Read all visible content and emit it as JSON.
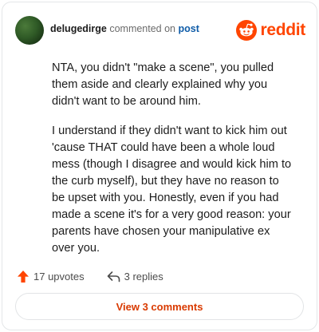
{
  "comment": {
    "username": "delugedirge",
    "action": "commented on",
    "target": "post",
    "paragraphs": [
      "NTA, you didn't \"make a scene\", you pulled them aside and clearly explained why you didn't want to be around him.",
      "I understand if they didn't want to kick him out 'cause THAT could have been a whole loud mess (though I disagree and would kick him to the curb myself), but they have no reason to be upset with you. Honestly, even if you had made a scene it's for a very good reason: your parents have chosen your manipulative ex over you."
    ]
  },
  "brand": {
    "name": "reddit",
    "icon": "reddit-logo-icon",
    "color": "#ff4500"
  },
  "footer": {
    "upvotes": "17 upvotes",
    "replies": "3 replies",
    "upvote_icon": "upvote-arrow-icon",
    "reply_icon": "reply-arrow-icon",
    "upvote_color": "#ff4500"
  },
  "view_comments": {
    "label": "View 3 comments",
    "color": "#d93a00"
  }
}
